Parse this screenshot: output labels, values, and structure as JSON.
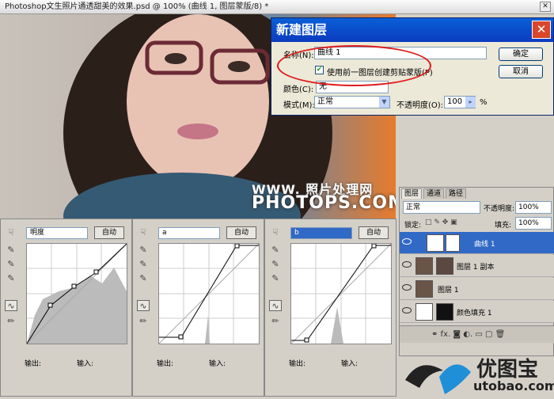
{
  "window": {
    "title": "Photoshop文生照片通透甜美的效果.psd @ 100% (曲线 1, 图层蒙版/8) *"
  },
  "watermark": {
    "line1": "WWW. 照片处理网",
    "domain": "PHOTOPS.COM"
  },
  "dialog": {
    "title": "新建图层",
    "name_label": "名称(N):",
    "name_value": "曲线 1",
    "clip_label": "使用前一图层创建剪贴蒙版(P)",
    "clip_checked": true,
    "color_label": "颜色(C):",
    "color_value": "无",
    "mode_label": "模式(M):",
    "mode_value": "正常",
    "opacity_label": "不透明度(O):",
    "opacity_value": "100",
    "opacity_unit": "%",
    "ok": "确定",
    "cancel": "取消"
  },
  "layers": {
    "tabs": [
      "图层",
      "通道",
      "路径"
    ],
    "blend": "正常",
    "opacity_label": "不透明度:",
    "opacity": "100%",
    "lock_label": "锁定:",
    "fill_label": "填充:",
    "fill": "100%",
    "items": [
      "曲线 1",
      "图层 1 副本",
      "图层 1",
      "颜色填充 1"
    ]
  },
  "curves": [
    {
      "channel": "明度",
      "auto": "自动",
      "output": "输出:",
      "input": "输入:"
    },
    {
      "channel": "a",
      "auto": "自动",
      "output": "输出:",
      "input": "输入:"
    },
    {
      "channel": "b",
      "auto": "自动",
      "output": "输出:",
      "input": "输入:"
    }
  ],
  "logo": {
    "name": "优图宝",
    "domain": "utobao.com"
  }
}
